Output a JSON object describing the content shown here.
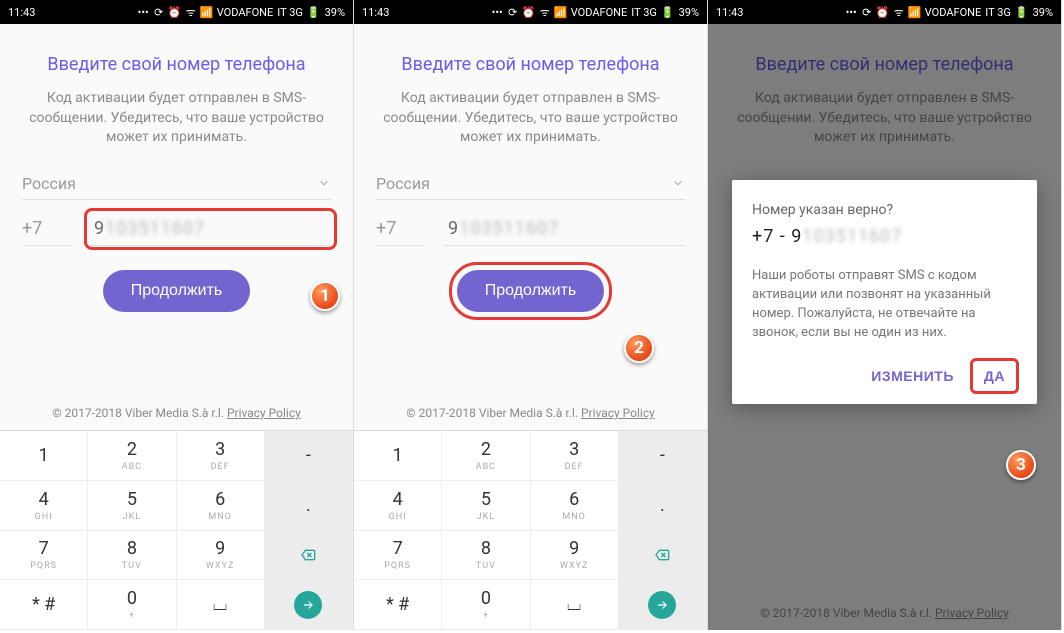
{
  "statusbar": {
    "time": "11:43",
    "carrier": "VODAFONE",
    "network": "IT 3G",
    "battery": "39%"
  },
  "screen": {
    "title": "Введите свой номер телефона",
    "description": "Код активации будет отправлен в SMS-сообщении. Убедитесь, что ваше устройство может их принимать.",
    "country": "Россия",
    "prefix": "+7",
    "number_clear": "9",
    "number_hidden": "103511607",
    "continue": "Продолжить",
    "footer_copyright": "© 2017-2018 Viber Media S.à r.l. ",
    "footer_pp": "Privacy Policy"
  },
  "keypad": {
    "r1": [
      {
        "n": "1",
        "s": ""
      },
      {
        "n": "2",
        "s": "ABC"
      },
      {
        "n": "3",
        "s": "DEF"
      },
      {
        "n": "-",
        "s": ""
      }
    ],
    "r2": [
      {
        "n": "4",
        "s": "GHI"
      },
      {
        "n": "5",
        "s": "JKL"
      },
      {
        "n": "6",
        "s": "MNO"
      },
      {
        "n": ".",
        "s": ""
      }
    ],
    "r3": [
      {
        "n": "7",
        "s": "PQRS"
      },
      {
        "n": "8",
        "s": "TUV"
      },
      {
        "n": "9",
        "s": "WXYZ"
      },
      {
        "n": "bs",
        "s": ""
      }
    ],
    "r4": [
      {
        "n": "* #",
        "s": ""
      },
      {
        "n": "0",
        "s": "+"
      },
      {
        "n": "⌴",
        "s": ""
      },
      {
        "n": "go",
        "s": ""
      }
    ]
  },
  "dialog": {
    "title": "Номер указан верно?",
    "number_prefix": "+7 - ",
    "number_clear": "9",
    "number_hidden": "103511607",
    "description": "Наши роботы отправят SMS с кодом активации или позвонят на указанный номер. Пожалуйста, не отвечайте на звонок, если вы не один из них.",
    "change": "ИЗМЕНИТЬ",
    "yes": "ДА"
  },
  "badges": {
    "b1": "1",
    "b2": "2",
    "b3": "3"
  }
}
